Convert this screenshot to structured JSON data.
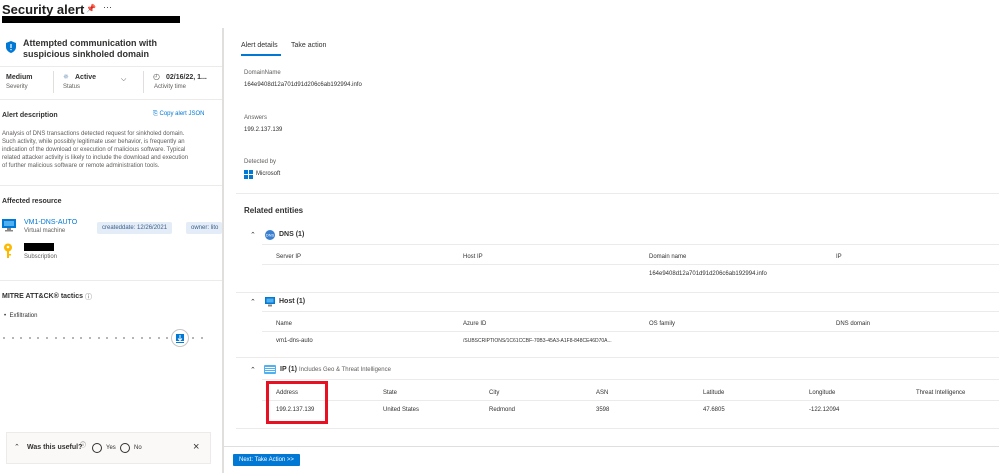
{
  "header": {
    "title": "Security alert",
    "pin_icon": "pin-icon",
    "more_icon": "more-icon"
  },
  "alert": {
    "title_line1": "Attempted communication with",
    "title_line2": "suspicious sinkholed domain",
    "severity_value": "Medium",
    "severity_label": "Severity",
    "status_value": "Active",
    "status_label": "Status",
    "activity_value": "02/16/22, 1...",
    "activity_label": "Activity time"
  },
  "description": {
    "heading": "Alert description",
    "copy_label": "Copy alert JSON",
    "lines": [
      "Analysis of DNS transactions detected request for sinkholed domain.",
      "Such activity, while possibly legitimate user behavior, is frequently an",
      "indication of the download or execution of malicious software. Typical",
      "related attacker activity is likely to include the download and execution",
      "of further malicious software or remote administration tools."
    ]
  },
  "affected": {
    "heading": "Affected resource",
    "vm_name": "VM1-DNS-AUTO",
    "vm_type": "Virtual machine",
    "tag1": "createddate: 12/26/2021",
    "tag2": "owner: lito",
    "sub_type": "Subscription"
  },
  "mitre": {
    "heading": "MITRE ATT&CK® tactics",
    "tactic": "Exfiltration"
  },
  "feedback": {
    "question": "Was this useful?",
    "yes": "Yes",
    "no": "No"
  },
  "tabs": {
    "details": "Alert details",
    "action": "Take action"
  },
  "details": {
    "domain_label": "DomainName",
    "domain_value": "164e9408d12a701d91d206c6ab192994.info",
    "answers_label": "Answers",
    "answers_value": "199.2.137.139",
    "detected_label": "Detected by",
    "detected_value": "Microsoft"
  },
  "entities": {
    "heading": "Related entities",
    "dns": {
      "title": "DNS (1)",
      "columns": [
        "Server IP",
        "Host IP",
        "Domain name",
        "IP"
      ],
      "row": [
        "",
        "",
        "164e9408d12a701d91d206c6ab192994.info",
        ""
      ]
    },
    "host": {
      "title": "Host (1)",
      "columns": [
        "Name",
        "Azure ID",
        "OS family",
        "DNS domain"
      ],
      "row": [
        "vm1-dns-auto",
        "/SUBSCRIPTIONS/1C61CCBF-70B3-45A3-A1F8-848CE46D70A...",
        "",
        ""
      ]
    },
    "ip": {
      "title": "IP (1)",
      "subtitle": "Includes Geo & Threat Intelligence",
      "columns": [
        "Address",
        "State",
        "City",
        "ASN",
        "Latitude",
        "Longitude",
        "Threat Intelligence"
      ],
      "row": [
        "199.2.137.139",
        "United States",
        "Redmond",
        "3598",
        "47.6805",
        "-122.12094",
        ""
      ]
    }
  },
  "next_button": "Next: Take Action >>",
  "colors": {
    "accent": "#0078d4",
    "highlight": "#e81123"
  }
}
